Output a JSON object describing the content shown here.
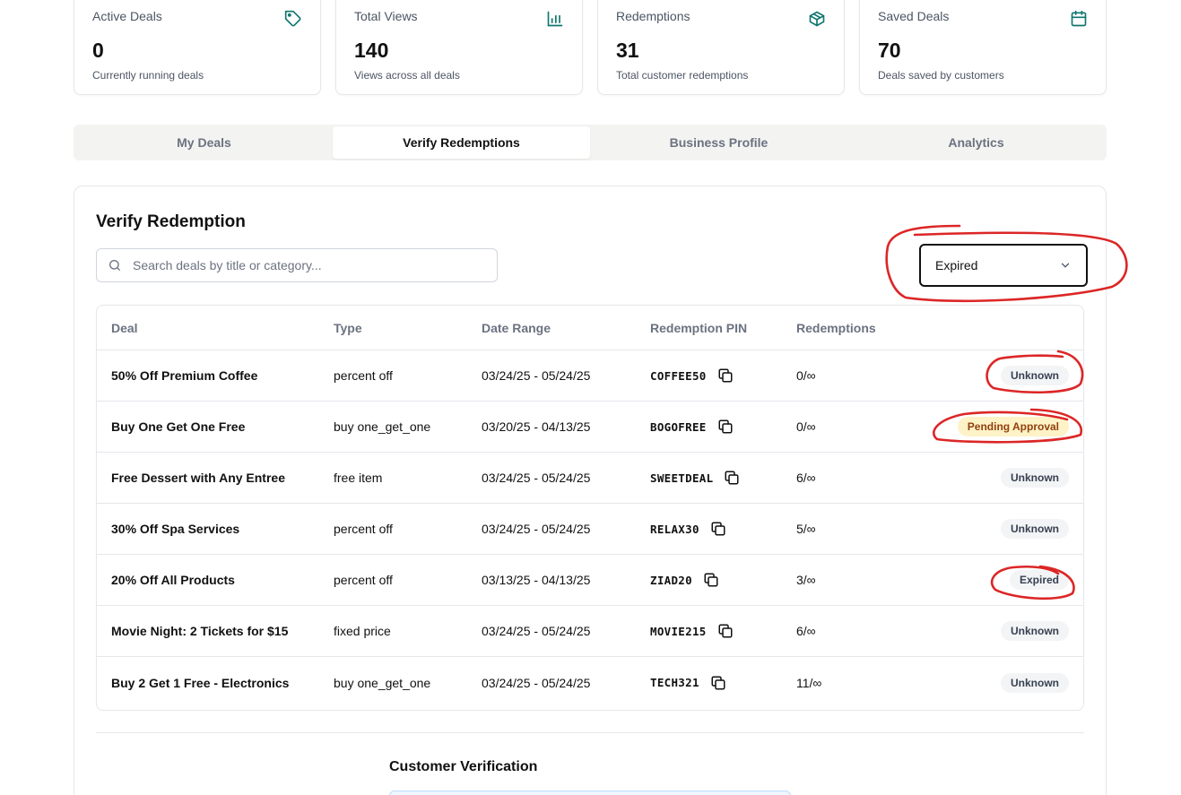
{
  "stats": [
    {
      "title": "Active Deals",
      "value": "0",
      "sub": "Currently running deals",
      "icon": "tag-icon"
    },
    {
      "title": "Total Views",
      "value": "140",
      "sub": "Views across all deals",
      "icon": "bar-chart-icon"
    },
    {
      "title": "Redemptions",
      "value": "31",
      "sub": "Total customer redemptions",
      "icon": "package-icon"
    },
    {
      "title": "Saved Deals",
      "value": "70",
      "sub": "Deals saved by customers",
      "icon": "calendar-icon"
    }
  ],
  "tabs": [
    {
      "label": "My Deals"
    },
    {
      "label": "Verify Redemptions",
      "active": true
    },
    {
      "label": "Business Profile"
    },
    {
      "label": "Analytics"
    }
  ],
  "panel": {
    "title": "Verify Redemption",
    "search_placeholder": "Search deals by title or category...",
    "filter_value": "Expired"
  },
  "table": {
    "headers": {
      "deal": "Deal",
      "type": "Type",
      "date": "Date Range",
      "pin": "Redemption PIN",
      "redemptions": "Redemptions"
    },
    "rows": [
      {
        "deal": "50% Off Premium Coffee",
        "type": "percent off",
        "date": "03/24/25 - 05/24/25",
        "pin": "COFFEE50",
        "redemptions": "0/∞",
        "status": "Unknown"
      },
      {
        "deal": "Buy One Get One Free",
        "type": "buy one_get_one",
        "date": "03/20/25 - 04/13/25",
        "pin": "BOGOFREE",
        "redemptions": "0/∞",
        "status": "Pending Approval"
      },
      {
        "deal": "Free Dessert with Any Entree",
        "type": "free item",
        "date": "03/24/25 - 05/24/25",
        "pin": "SWEETDEAL",
        "redemptions": "6/∞",
        "status": "Unknown"
      },
      {
        "deal": "30% Off Spa Services",
        "type": "percent off",
        "date": "03/24/25 - 05/24/25",
        "pin": "RELAX30",
        "redemptions": "5/∞",
        "status": "Unknown"
      },
      {
        "deal": "20% Off All Products",
        "type": "percent off",
        "date": "03/13/25 - 04/13/25",
        "pin": "ZIAD20",
        "redemptions": "3/∞",
        "status": "Expired"
      },
      {
        "deal": "Movie Night: 2 Tickets for $15",
        "type": "fixed price",
        "date": "03/24/25 - 05/24/25",
        "pin": "MOVIE215",
        "redemptions": "6/∞",
        "status": "Unknown"
      },
      {
        "deal": "Buy 2 Get 1 Free - Electronics",
        "type": "buy one_get_one",
        "date": "03/24/25 - 05/24/25",
        "pin": "TECH321",
        "redemptions": "11/∞",
        "status": "Unknown"
      }
    ]
  },
  "customer_verification": {
    "title": "Customer Verification"
  },
  "colors": {
    "accent": "#0f766e",
    "annotation": "#dc2626",
    "pending_bg": "#fef3c7",
    "badge_bg": "#f3f4f6"
  }
}
